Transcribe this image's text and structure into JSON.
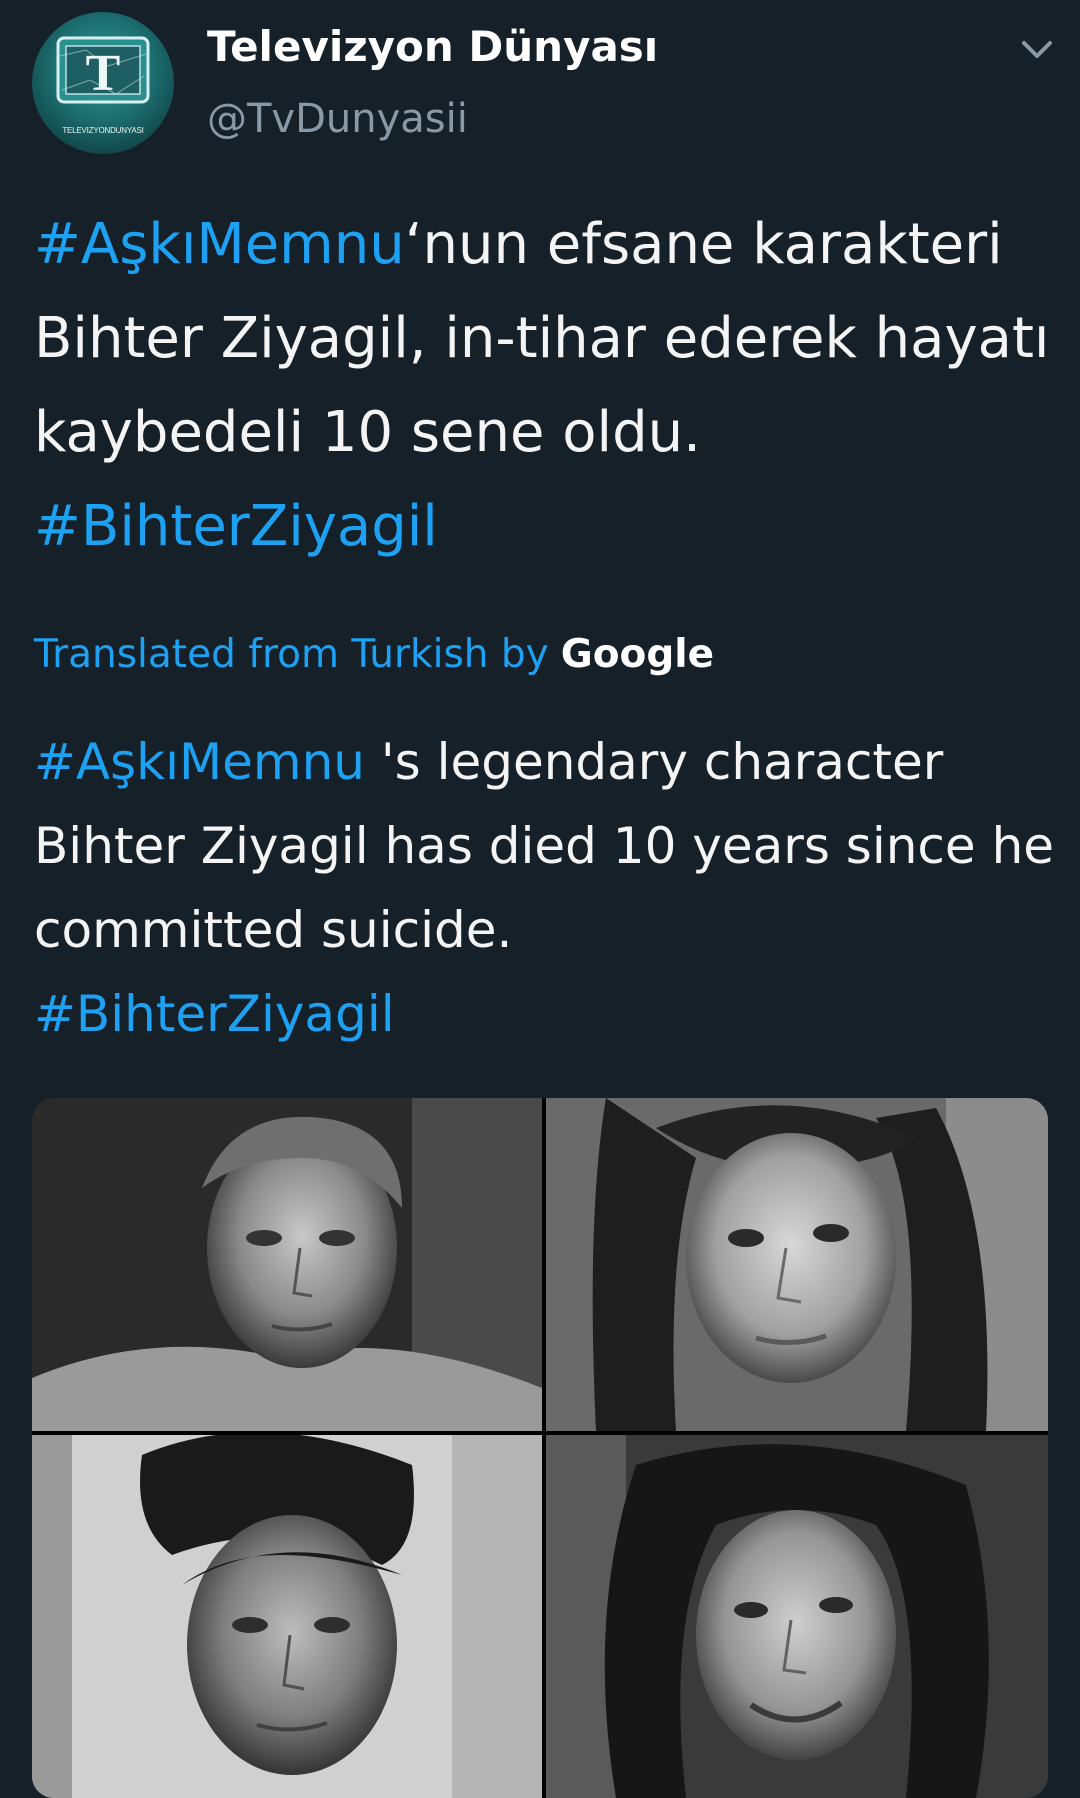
{
  "account": {
    "display_name": "Televizyon Dünyası",
    "handle": "@TvDunyasii",
    "avatar_letter": "T",
    "avatar_text": "TELEVIZYONDUNYASI"
  },
  "tweet": {
    "original": {
      "hashtag_1": "#AşkıMemnu",
      "text_1": "‘nun efsane karakteri Bihter Ziyagil, in-tihar ederek hayatı kaybedeli 10 sene oldu. ",
      "hashtag_2": "#BihterZiyagil"
    },
    "translated_label": "Translated from Turkish by",
    "translator": "Google",
    "translation": {
      "hashtag_1": "#AşkıMemnu",
      "text_1": " 's legendary character Bihter Ziyagil has died 10 years since he committed suicide.",
      "hashtag_2": "#BihterZiyagil"
    }
  },
  "icons": {
    "menu": "chevron-down-icon"
  },
  "colors": {
    "background": "#162029",
    "link": "#1da1f2",
    "secondary_text": "#8a99a6",
    "primary_text": "#f4f4f4"
  }
}
